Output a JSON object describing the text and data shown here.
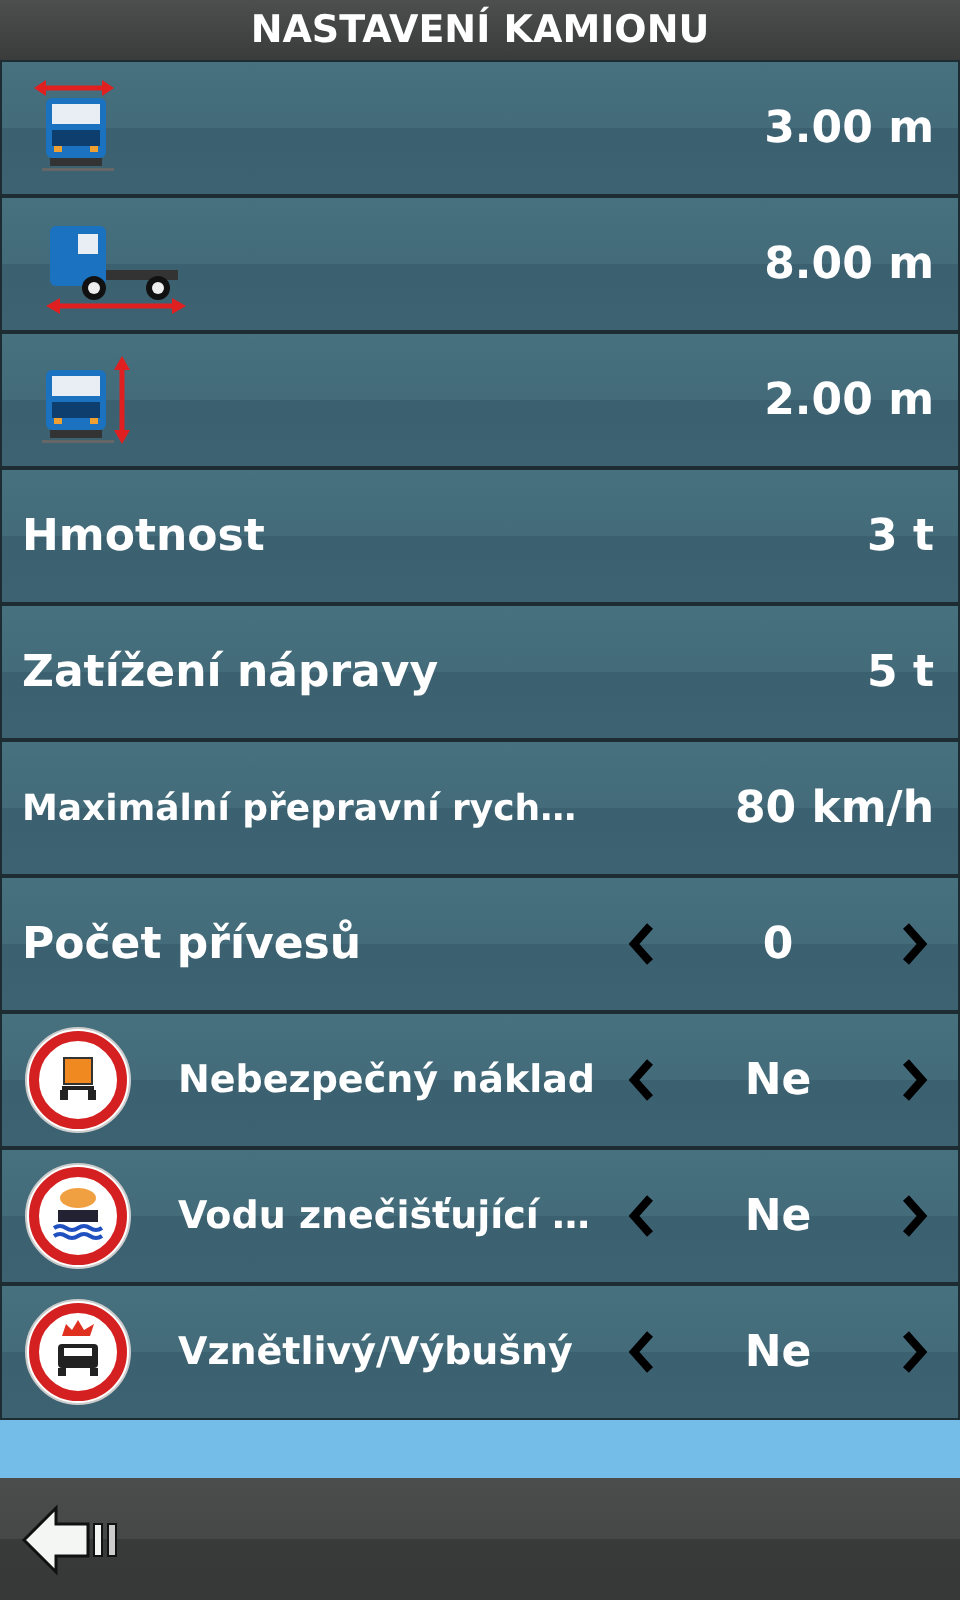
{
  "title": "NASTAVENÍ KAMIONU",
  "rows": [
    {
      "kind": "width",
      "value": "3.00 m"
    },
    {
      "kind": "length",
      "value": "8.00 m"
    },
    {
      "kind": "height",
      "value": "2.00 m"
    },
    {
      "kind": "text",
      "label": "Hmotnost",
      "value": "3 t"
    },
    {
      "kind": "text",
      "label": "Zatížení nápravy",
      "value": "5 t"
    },
    {
      "kind": "text-small",
      "label": "Maximální přepravní rych…",
      "value": "80 km/h"
    },
    {
      "kind": "stepper",
      "label": "Počet přívesů",
      "value": "0"
    },
    {
      "kind": "hazard",
      "label": "Nebezpečný náklad",
      "value": "Ne"
    },
    {
      "kind": "water",
      "label": "Vodu znečišťující …",
      "value": "Ne"
    },
    {
      "kind": "explosive",
      "label": "Vznětlivý/Výbušný",
      "value": "Ne"
    }
  ]
}
